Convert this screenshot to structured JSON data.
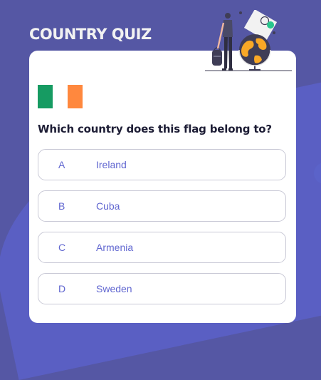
{
  "quiz": {
    "title": "COUNTRY QUIZ",
    "question": "Which country does this flag belong to?",
    "flag_colors": [
      "#169b62",
      "#ffffff",
      "#ff883e"
    ],
    "answers": [
      {
        "letter": "A",
        "text": "Ireland"
      },
      {
        "letter": "B",
        "text": "Cuba"
      },
      {
        "letter": "C",
        "text": "Armenia"
      },
      {
        "letter": "D",
        "text": "Sweden"
      }
    ]
  },
  "colors": {
    "background": "#5557a4",
    "accent": "#6066d0",
    "card": "#ffffff"
  },
  "icons": {
    "illustration": "traveler-globe-illustration"
  }
}
